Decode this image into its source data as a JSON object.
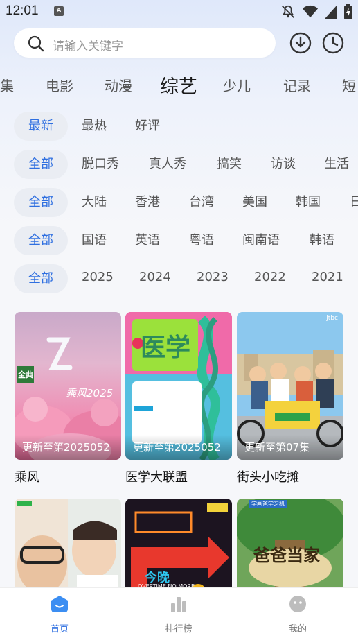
{
  "status_bar": {
    "time": "12:01",
    "notification_badge": "A"
  },
  "search": {
    "placeholder": "请输入关键字"
  },
  "categories": [
    "集",
    "电影",
    "动漫",
    "综艺",
    "少儿",
    "记录",
    "短"
  ],
  "active_category": "综艺",
  "filters": {
    "sort": [
      "最新",
      "最热",
      "好评"
    ],
    "genre": [
      "全部",
      "脱口秀",
      "真人秀",
      "搞笑",
      "访谈",
      "生活"
    ],
    "region": [
      "全部",
      "大陆",
      "香港",
      "台湾",
      "美国",
      "韩国",
      "日"
    ],
    "language": [
      "全部",
      "国语",
      "英语",
      "粤语",
      "闽南语",
      "韩语"
    ],
    "year": [
      "全部",
      "2025",
      "2024",
      "2023",
      "2022",
      "2021"
    ]
  },
  "cards": [
    {
      "title": "乘风",
      "badge": "更新至第2025052",
      "poster_text": "乘风2025",
      "poster_tag": "全典"
    },
    {
      "title": "医学大联盟",
      "badge": "更新至第2025052",
      "poster_text": "医学",
      "poster_tag": ""
    },
    {
      "title": "街头小吃摊",
      "badge": "更新至第07集",
      "poster_text": "jtbc",
      "poster_tag": ""
    },
    {
      "title": "",
      "badge": "",
      "poster_text": "",
      "poster_tag": ""
    },
    {
      "title": "",
      "badge": "",
      "poster_text": "OVERTIME NO MORE",
      "poster_tag": "今晚"
    },
    {
      "title": "",
      "badge": "",
      "poster_text": "爸爸当家",
      "poster_tag": "学画爸学习机"
    }
  ],
  "bottom_nav": [
    {
      "label": "首页",
      "icon": "home-icon",
      "active": true
    },
    {
      "label": "排行榜",
      "icon": "chart-icon",
      "active": false
    },
    {
      "label": "我的",
      "icon": "profile-icon",
      "active": false
    }
  ],
  "colors": {
    "accent": "#2f6fe0",
    "chip_bg": "#eaedf3",
    "background": "#f6f7fa"
  }
}
